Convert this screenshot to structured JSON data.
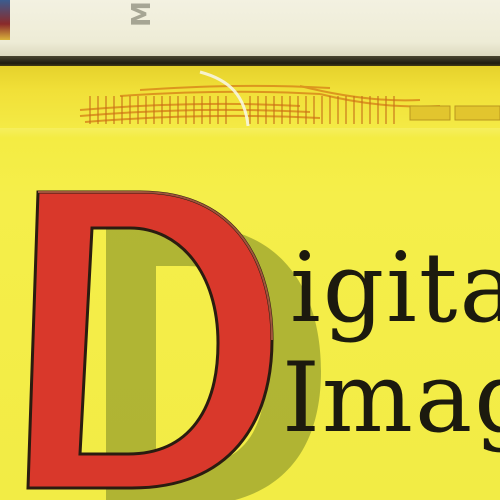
{
  "scene": {
    "top_book": {
      "spine_text": "M"
    },
    "title": {
      "initial": "D",
      "line1": "igita",
      "line2": "Imag"
    },
    "colors": {
      "spine_yellow": "#f2ec45",
      "initial_red": "#d9382b",
      "text_dark": "#1c1a0e",
      "band_orange": "#d98a1a"
    }
  }
}
